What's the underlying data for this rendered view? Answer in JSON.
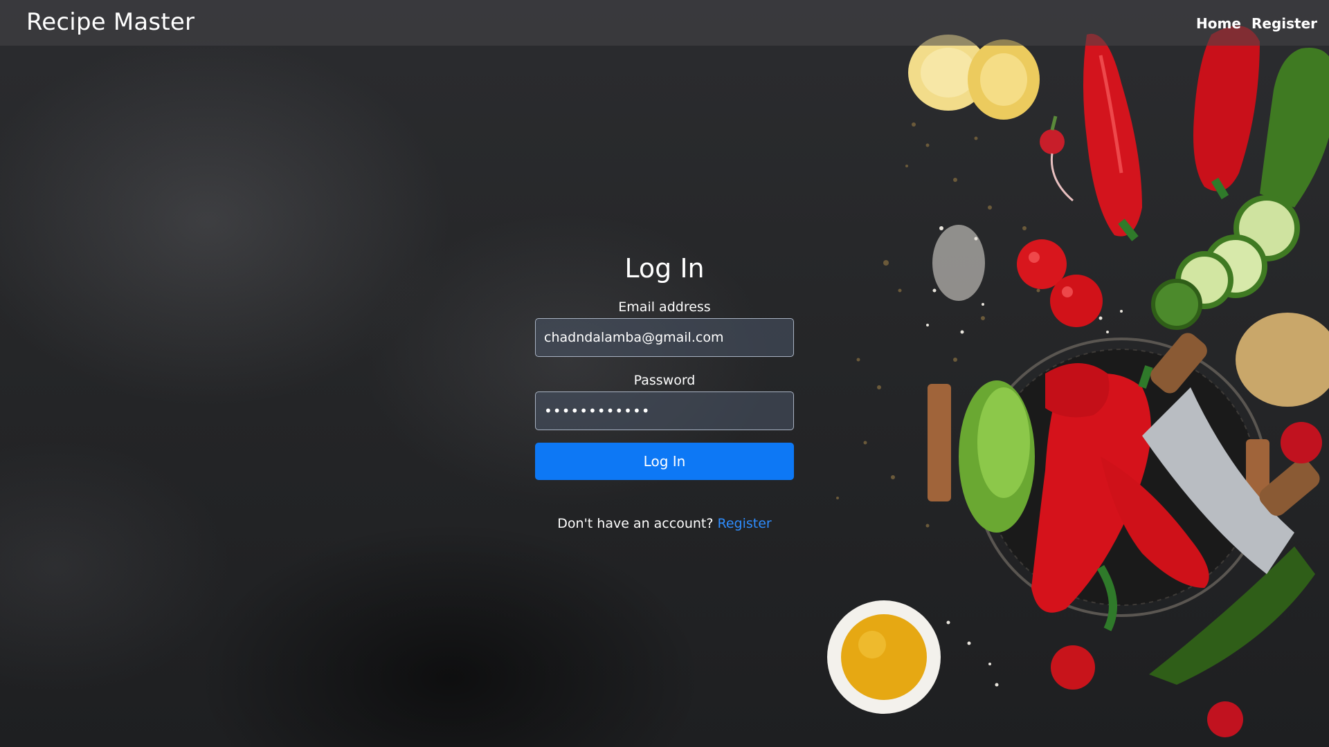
{
  "navbar": {
    "brand": "Recipe Master",
    "links": [
      {
        "label": "Home"
      },
      {
        "label": "Register"
      }
    ]
  },
  "login": {
    "title": "Log In",
    "email_label": "Email address",
    "email_value": "chadndalamba@gmail.com",
    "password_label": "Password",
    "password_value": "••••••••••••",
    "submit_label": "Log In",
    "signup_prompt": "Don't have an account?",
    "signup_link": "Register"
  },
  "colors": {
    "primary_button": "#0d78f5",
    "link": "#2e8dff",
    "background": "#262729"
  },
  "background_image": {
    "subject": "vegetables-on-dark-slate"
  }
}
